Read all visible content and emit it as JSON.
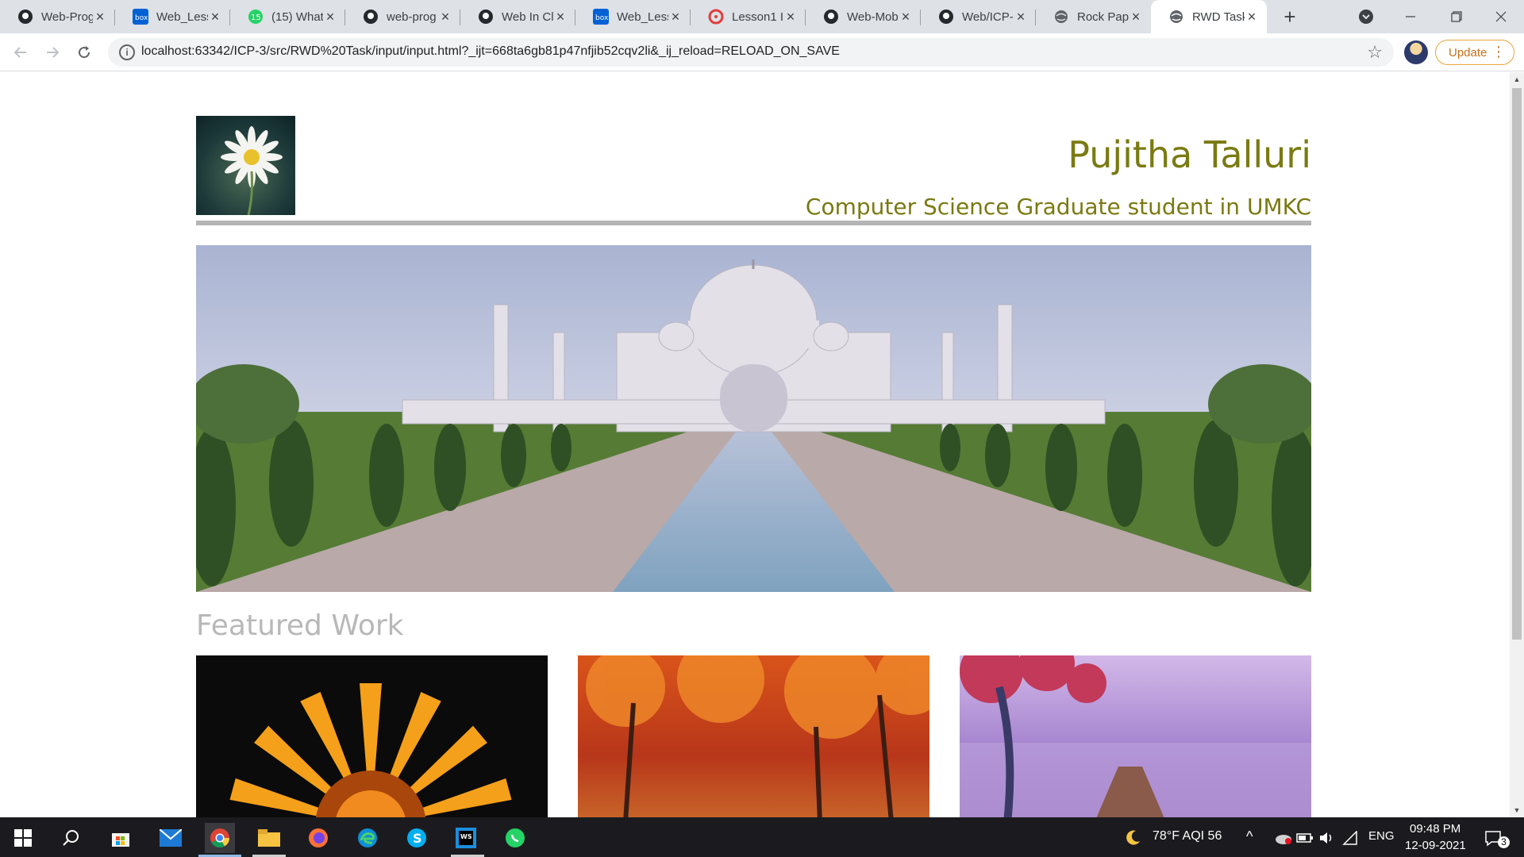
{
  "browser": {
    "tabs": [
      {
        "title": "Web-Prog",
        "icon": "github-icon"
      },
      {
        "title": "Web_Less",
        "icon": "box-icon"
      },
      {
        "title": "(15) What",
        "icon": "whatsapp-icon"
      },
      {
        "title": "web-prog",
        "icon": "github-icon"
      },
      {
        "title": "Web In Cl",
        "icon": "github-icon"
      },
      {
        "title": "Web_Less",
        "icon": "box-icon"
      },
      {
        "title": "Lesson1 I",
        "icon": "wheel-icon"
      },
      {
        "title": "Web-Mob",
        "icon": "github-icon"
      },
      {
        "title": "Web/ICP-",
        "icon": "github-icon"
      },
      {
        "title": "Rock Pape",
        "icon": "globe-icon"
      },
      {
        "title": "RWD Task",
        "icon": "globe-icon",
        "active": true
      }
    ],
    "url": "localhost:63342/ICP-3/src/RWD%20Task/input/input.html?_ijt=668ta6gb81p47nfjib52cqv2li&_ij_reload=RELOAD_ON_SAVE",
    "update_label": "Update"
  },
  "page": {
    "name": "Pujitha Talluri",
    "subtitle": "Computer Science Graduate student in UMKC",
    "featured_heading": "Featured Work"
  },
  "taskbar": {
    "weather": "78°F  AQI 56",
    "lang": "ENG",
    "time": "09:48 PM",
    "date": "12-09-2021",
    "notifications": "3"
  },
  "colors": {
    "accent_text": "#7a7a12",
    "rule": "#b5b5b5",
    "featured": "#b8b8b8",
    "update": "#c7711b"
  }
}
